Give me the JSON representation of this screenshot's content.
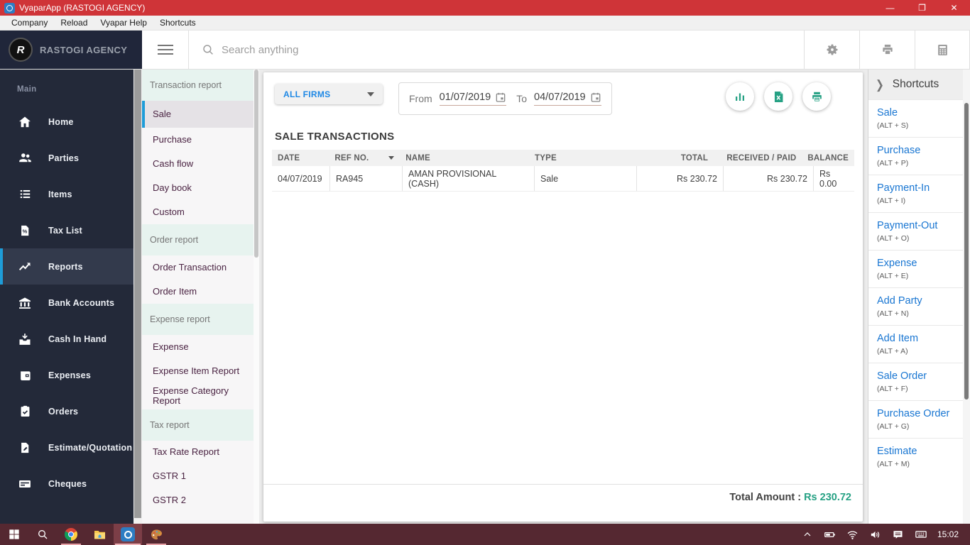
{
  "colors": {
    "titlebar_red": "#cf3438",
    "taskbar_maroon": "#552831",
    "sidebar_dark": "#232939",
    "accent_blue_bar": "#1e9cd8",
    "firm_link_blue": "#1e88e5",
    "shortcut_blue": "#1976d2",
    "teal_accent": "#26a184",
    "subnav_text_plum": "#4a2342"
  },
  "titlebar": {
    "title": "VyaparApp (RASTOGI AGENCY)"
  },
  "menubar": {
    "items": [
      "Company",
      "Reload",
      "Vyapar Help",
      "Shortcuts"
    ]
  },
  "header": {
    "company": "RASTOGI AGENCY",
    "logo_text": "R",
    "search_placeholder": "Search anything"
  },
  "nav": {
    "section_label": "Main",
    "items": [
      {
        "label": "Home"
      },
      {
        "label": "Parties"
      },
      {
        "label": "Items"
      },
      {
        "label": "Tax List"
      },
      {
        "label": "Reports"
      },
      {
        "label": "Bank Accounts"
      },
      {
        "label": "Cash In Hand"
      },
      {
        "label": "Expenses"
      },
      {
        "label": "Orders"
      },
      {
        "label": "Estimate/Quotation"
      },
      {
        "label": "Cheques"
      }
    ],
    "selected": "Reports"
  },
  "subnav": {
    "sections": [
      {
        "title": "Transaction report",
        "items": [
          "Sale",
          "Purchase",
          "Cash flow",
          "Day book",
          "Custom"
        ]
      },
      {
        "title": "Order report",
        "items": [
          "Order Transaction",
          "Order Item"
        ]
      },
      {
        "title": "Expense report",
        "items": [
          "Expense",
          "Expense Item Report",
          "Expense Category Report"
        ]
      },
      {
        "title": "Tax report",
        "items": [
          "Tax Rate Report",
          "GSTR 1",
          "GSTR 2"
        ]
      }
    ],
    "selected": "Sale"
  },
  "filters": {
    "firm": "ALL FIRMS",
    "from_label": "From",
    "from_date": "01/07/2019",
    "to_label": "To",
    "to_date": "04/07/2019"
  },
  "report": {
    "title": "SALE TRANSACTIONS",
    "columns": [
      "DATE",
      "REF NO.",
      "NAME",
      "TYPE",
      "TOTAL",
      "RECEIVED / PAID",
      "BALANCE"
    ],
    "rows": [
      [
        "04/07/2019",
        "RA945",
        "AMAN PROVISIONAL (CASH)",
        "Sale",
        "Rs 230.72",
        "Rs 230.72",
        "Rs 0.00"
      ]
    ],
    "total_label": "Total Amount :",
    "total_value": "Rs 230.72"
  },
  "shortcuts": {
    "title": "Shortcuts",
    "items": [
      {
        "label": "Sale",
        "key": "(ALT + S)"
      },
      {
        "label": "Purchase",
        "key": "(ALT + P)"
      },
      {
        "label": "Payment-In",
        "key": "(ALT + I)"
      },
      {
        "label": "Payment-Out",
        "key": "(ALT + O)"
      },
      {
        "label": "Expense",
        "key": "(ALT + E)"
      },
      {
        "label": "Add Party",
        "key": "(ALT + N)"
      },
      {
        "label": "Add Item",
        "key": "(ALT + A)"
      },
      {
        "label": "Sale Order",
        "key": "(ALT + F)"
      },
      {
        "label": "Purchase Order",
        "key": "(ALT + G)"
      },
      {
        "label": "Estimate",
        "key": "(ALT + M)"
      }
    ]
  },
  "taskbar": {
    "time": "15:02"
  }
}
